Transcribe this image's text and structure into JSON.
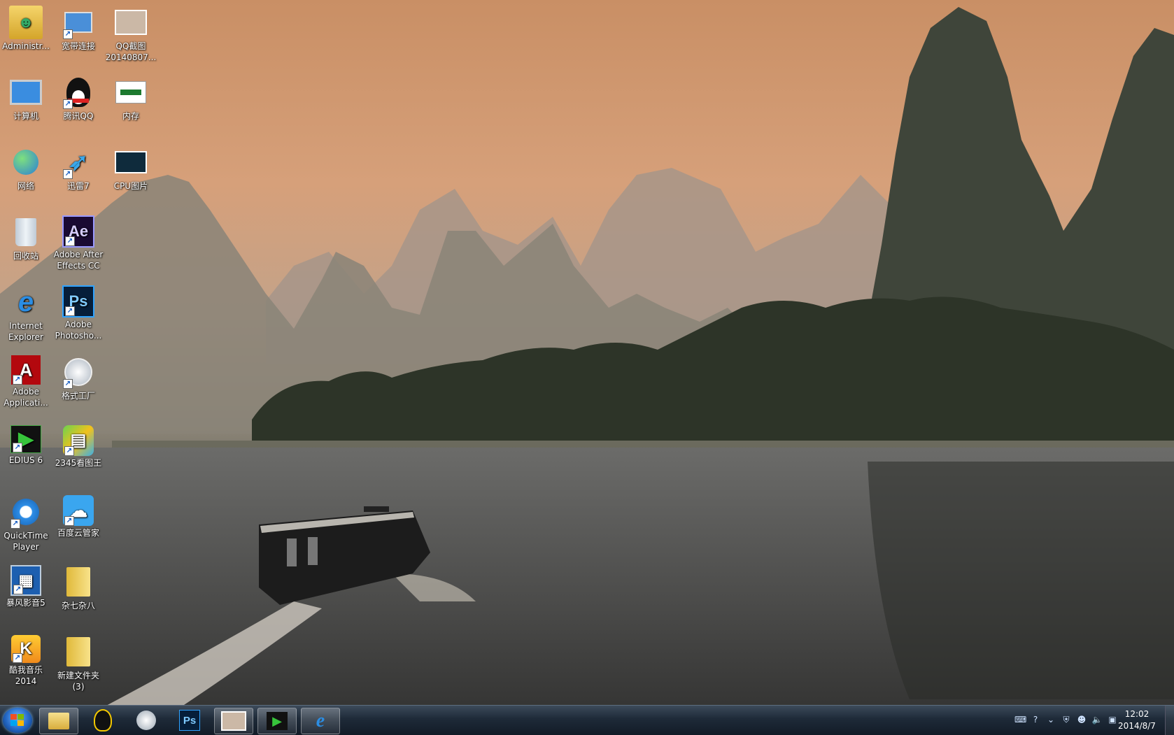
{
  "desktop": {
    "icons": [
      {
        "label": "Administr...",
        "icon": "user-folder-icon"
      },
      {
        "label": "宽带连接",
        "icon": "network-connection-icon"
      },
      {
        "label": "QQ截图\n20140807...",
        "icon": "image-thumbnail-icon"
      },
      {
        "label": "计算机",
        "icon": "computer-icon"
      },
      {
        "label": "腾讯QQ",
        "icon": "qq-penguin-icon"
      },
      {
        "label": "内存",
        "icon": "memory-chip-icon"
      },
      {
        "label": "网络",
        "icon": "network-globe-icon"
      },
      {
        "label": "迅雷7",
        "icon": "thunder-bird-icon"
      },
      {
        "label": "CPU图片",
        "icon": "image-thumbnail-icon"
      },
      {
        "label": "回收站",
        "icon": "recycle-bin-icon"
      },
      {
        "label": "Adobe After\nEffects CC",
        "icon": "after-effects-icon"
      },
      {
        "label": "Internet\nExplorer",
        "icon": "internet-explorer-icon"
      },
      {
        "label": "Adobe\nPhotosho...",
        "icon": "photoshop-icon"
      },
      {
        "label": "Adobe\nApplicati...",
        "icon": "adobe-acrobat-icon"
      },
      {
        "label": "格式工厂",
        "icon": "format-factory-icon"
      },
      {
        "label": "EDIUS 6",
        "icon": "edius-icon"
      },
      {
        "label": "2345看图王",
        "icon": "image-viewer-icon"
      },
      {
        "label": "QuickTime\nPlayer",
        "icon": "quicktime-icon"
      },
      {
        "label": "百度云管家",
        "icon": "baidu-cloud-icon"
      },
      {
        "label": "暴风影音5",
        "icon": "storm-player-icon"
      },
      {
        "label": "杂七杂八",
        "icon": "folder-icon"
      },
      {
        "label": "酷我音乐\n2014",
        "icon": "kuwo-music-icon"
      },
      {
        "label": "新建文件夹\n(3)",
        "icon": "folder-icon"
      }
    ]
  },
  "taskbar": {
    "pinned": [
      {
        "name": "explorer",
        "icon": "folder-icon",
        "glyph": "📁"
      },
      {
        "name": "qq",
        "icon": "qq-penguin-icon",
        "glyph": "🐧"
      },
      {
        "name": "format-factory",
        "icon": "format-factory-icon",
        "glyph": "⚙"
      },
      {
        "name": "photoshop",
        "icon": "photoshop-icon",
        "glyph": "Ps"
      },
      {
        "name": "qq-screenshot",
        "icon": "image-thumbnail-icon",
        "glyph": "▣"
      },
      {
        "name": "edius",
        "icon": "edius-icon",
        "glyph": "▶"
      },
      {
        "name": "ie",
        "icon": "internet-explorer-icon",
        "glyph": "e"
      }
    ],
    "clock": {
      "time": "12:02",
      "date": "2014/8/7"
    }
  }
}
